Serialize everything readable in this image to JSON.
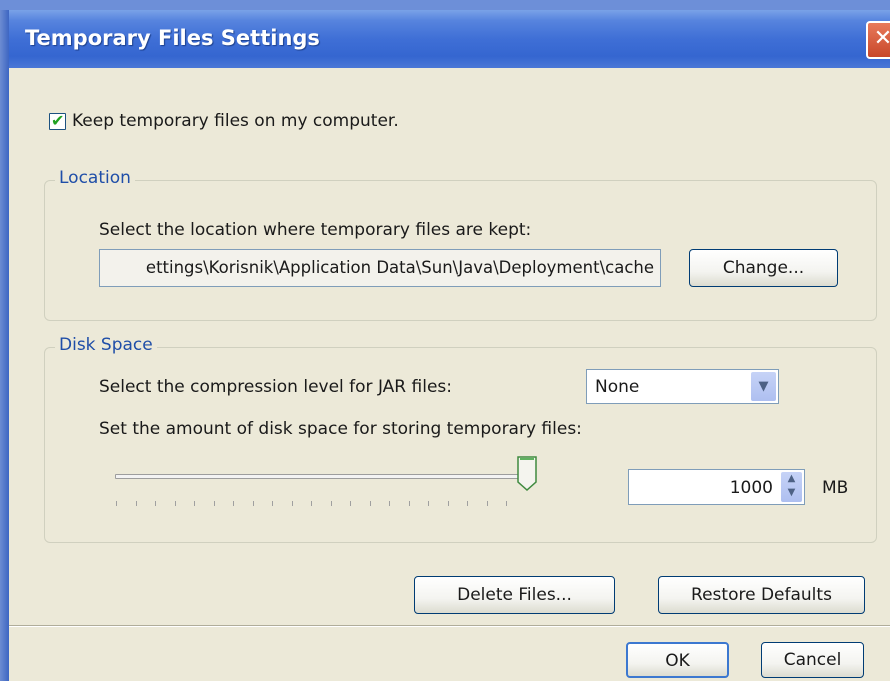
{
  "window": {
    "title": "Temporary Files Settings",
    "close_glyph": "✕"
  },
  "keep_files": {
    "checked": true,
    "label": "Keep temporary files on my computer."
  },
  "location": {
    "legend": "Location",
    "instruction": "Select the location where temporary files are kept:",
    "path": "ettings\\Korisnik\\Application Data\\Sun\\Java\\Deployment\\cache",
    "change_label": "Change..."
  },
  "disk_space": {
    "legend": "Disk Space",
    "compression_label": "Select the compression level for JAR files:",
    "compression_value": "None",
    "amount_label": "Set the amount of disk space for storing temporary files:",
    "slider_level": 1.0,
    "size_value": "1000",
    "unit": "MB"
  },
  "buttons": {
    "delete": "Delete Files...",
    "restore": "Restore Defaults",
    "ok": "OK",
    "cancel": "Cancel"
  },
  "colors": {
    "titlebar": "#3566d0",
    "dialog_bg": "#ece9d8",
    "legend": "#1f4ea8"
  }
}
